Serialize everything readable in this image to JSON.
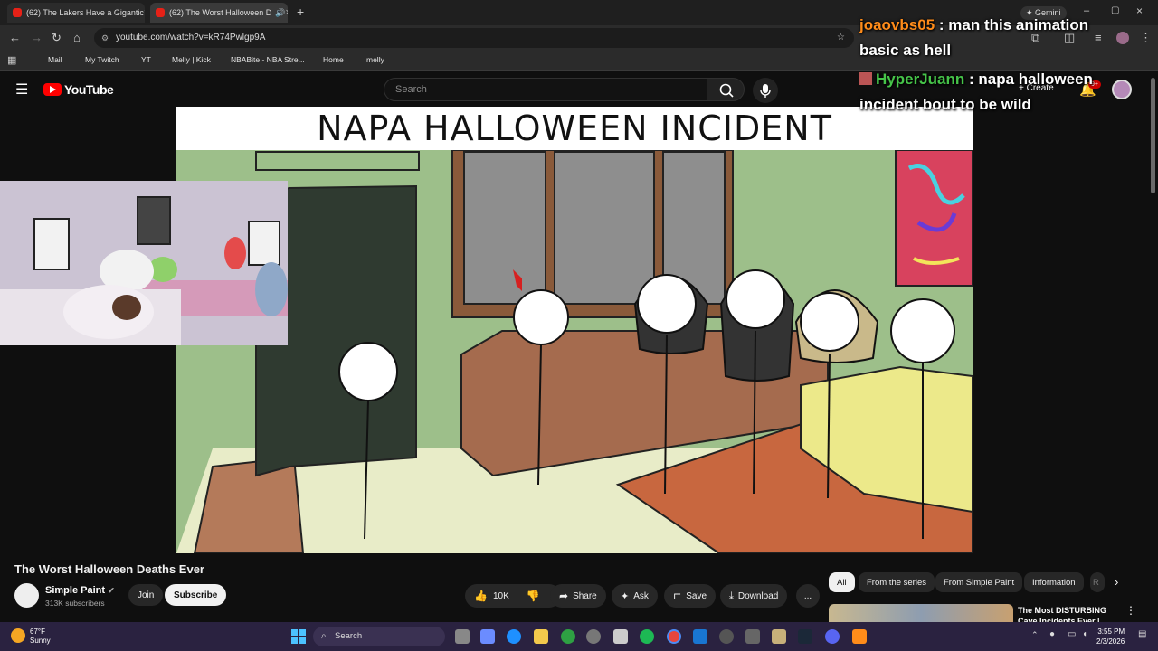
{
  "browser": {
    "tabs": [
      {
        "title": "(62) The Lakers Have a Gigantic"
      },
      {
        "title": "(62) The Worst Halloween D"
      }
    ],
    "url": "youtube.com/watch?v=kR74Pwlgp9A",
    "bookmarks": [
      {
        "label": "Mail",
        "color": "#c5221f"
      },
      {
        "label": "My Twitch",
        "color": "#9146ff"
      },
      {
        "label": "YT",
        "color": "#e62117"
      },
      {
        "label": "Melly | Kick",
        "color": "#53fc18"
      },
      {
        "label": "NBABite - NBA Stre...",
        "color": "#c9082a"
      },
      {
        "label": "Home",
        "color": "#ffffff"
      },
      {
        "label": "melly",
        "color": "#1db954"
      }
    ],
    "gemini_label": "Gemini"
  },
  "youtube": {
    "logo_text": "YouTube",
    "search_placeholder": "Search",
    "create_label": "Create",
    "notif_count": "9+"
  },
  "video": {
    "frame_title": "NAPA HALLOWEEN INCIDENT"
  },
  "chat": [
    {
      "user": "joaovbs05",
      "message": " : man this animation basic as hell",
      "user_color": "#ff8c1a"
    },
    {
      "user": "HyperJuann",
      "message": " : napa halloween incident bout to be wild",
      "user_color": "#46c449"
    }
  ],
  "watch": {
    "title": "The Worst Halloween Deaths Ever",
    "channel": "Simple Paint",
    "subscribers": "313K subscribers",
    "join_label": "Join",
    "subscribe_label": "Subscribe",
    "likes": "10K",
    "share_label": "Share",
    "ask_label": "Ask",
    "save_label": "Save",
    "download_label": "Download",
    "more_label": "..."
  },
  "chips": [
    "All",
    "From the series",
    "From Simple Paint",
    "Information",
    "R"
  ],
  "recommended": {
    "title": "The Most DISTURBING Cave Incidents Ever |"
  },
  "taskbar": {
    "weather_temp": "67°F",
    "weather_desc": "Sunny",
    "search_label": "Search",
    "time": "3:55 PM",
    "date": "2/3/2026"
  },
  "colors": {
    "accent_red": "#e62117",
    "wall_green": "#9dbf8a",
    "couch_yellow": "#ece98a",
    "rug_orange": "#c8673f",
    "door_dark": "#2f3a30"
  }
}
